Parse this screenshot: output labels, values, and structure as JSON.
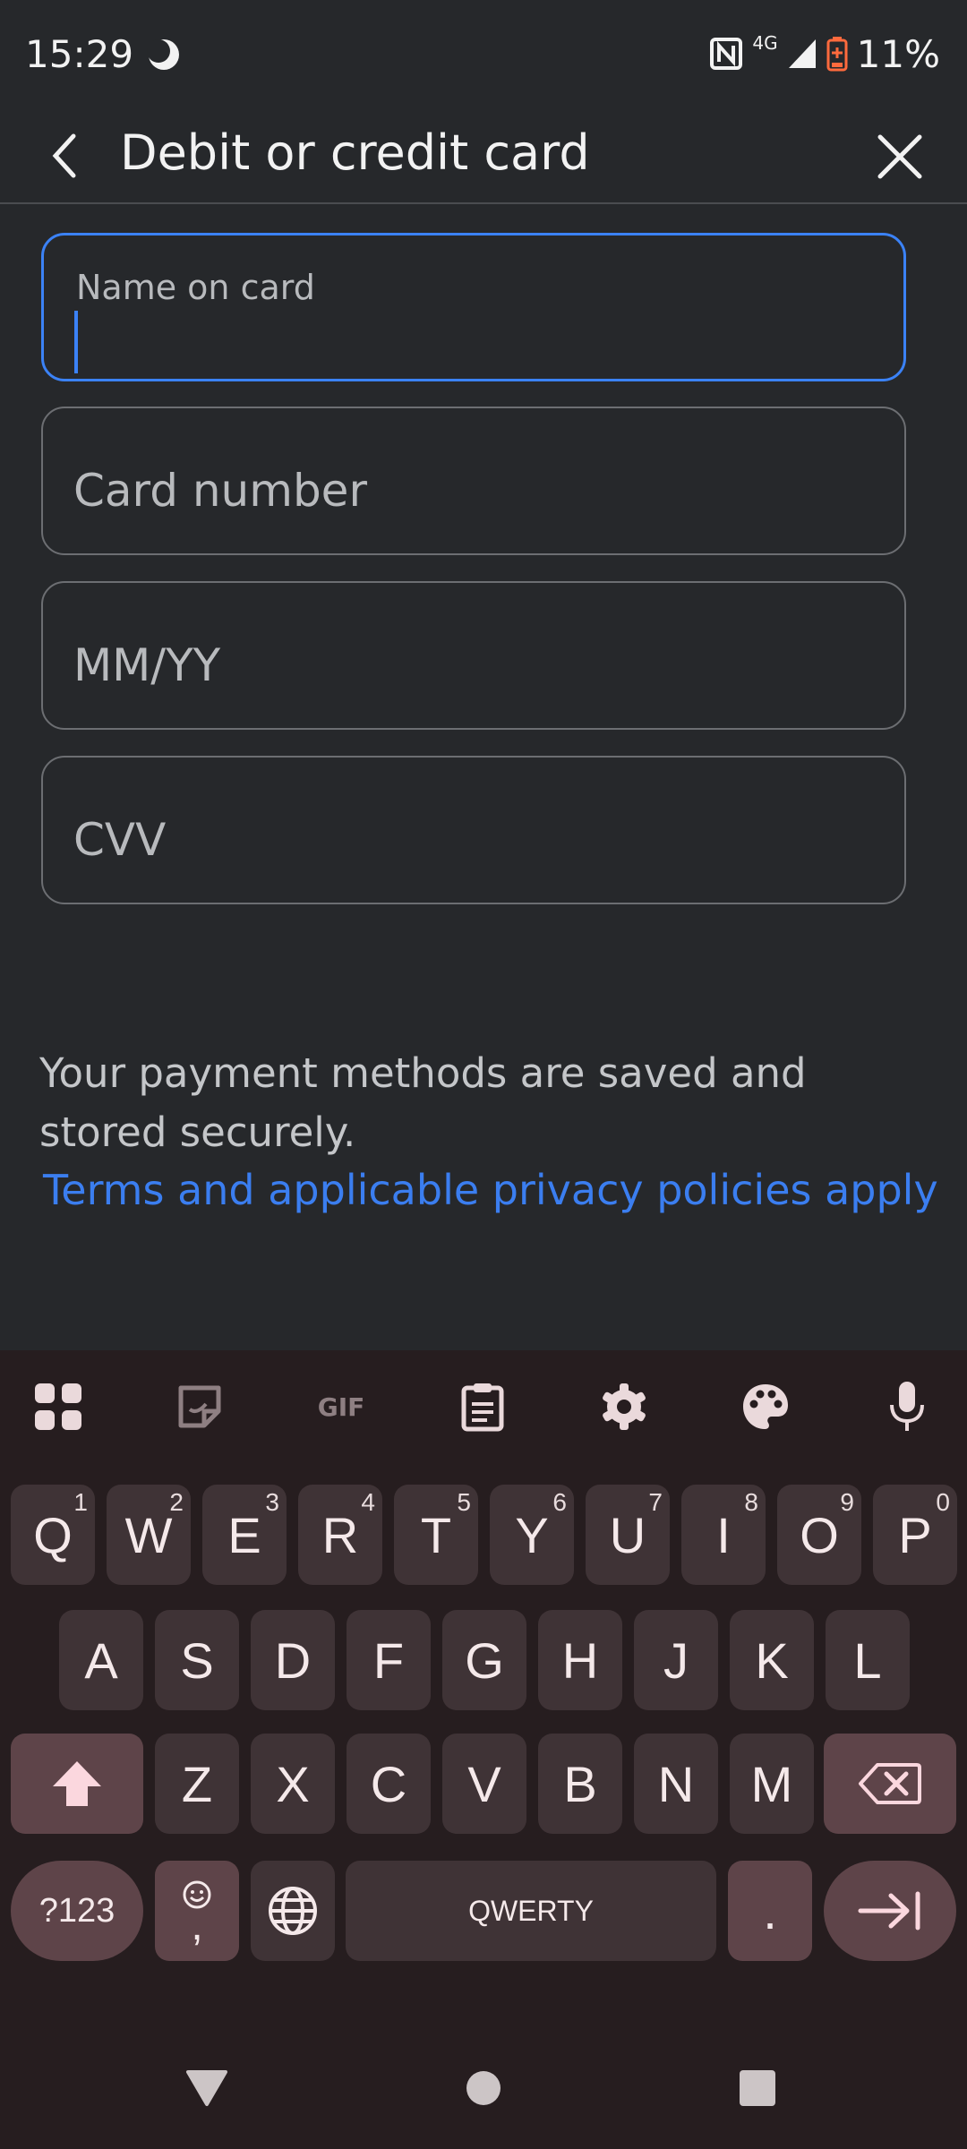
{
  "status_bar": {
    "time": "15:29",
    "battery": "11%",
    "network": "4G"
  },
  "app_bar": {
    "title": "Debit or credit card"
  },
  "form": {
    "name_label": "Name on card",
    "card_number_placeholder": "Card number",
    "expiry_placeholder": "MM/YY",
    "cvv_placeholder": "CVV"
  },
  "secure_note": "Your payment methods are saved and stored securely.",
  "terms_link": "Terms and applicable privacy policies apply",
  "keyboard": {
    "toolbar": [
      "apps-icon",
      "sticker-icon",
      "gif-icon",
      "clipboard-icon",
      "settings-icon",
      "palette-icon",
      "mic-icon"
    ],
    "row1": [
      {
        "key": "Q",
        "hint": "1"
      },
      {
        "key": "W",
        "hint": "2"
      },
      {
        "key": "E",
        "hint": "3"
      },
      {
        "key": "R",
        "hint": "4"
      },
      {
        "key": "T",
        "hint": "5"
      },
      {
        "key": "Y",
        "hint": "6"
      },
      {
        "key": "U",
        "hint": "7"
      },
      {
        "key": "I",
        "hint": "8"
      },
      {
        "key": "O",
        "hint": "9"
      },
      {
        "key": "P",
        "hint": "0"
      }
    ],
    "row2": [
      "A",
      "S",
      "D",
      "F",
      "G",
      "H",
      "J",
      "K",
      "L"
    ],
    "row3": [
      "Z",
      "X",
      "C",
      "V",
      "B",
      "N",
      "M"
    ],
    "symbols_label": "?123",
    "emoji_comma": ",",
    "space_label": "QWERTY",
    "period": "."
  },
  "colors": {
    "accent": "#3b82f6",
    "link": "#3b7ef0",
    "keyboard_bg": "#261d1f",
    "key_bg": "#3f3336",
    "special_key_bg": "#5e4449"
  }
}
